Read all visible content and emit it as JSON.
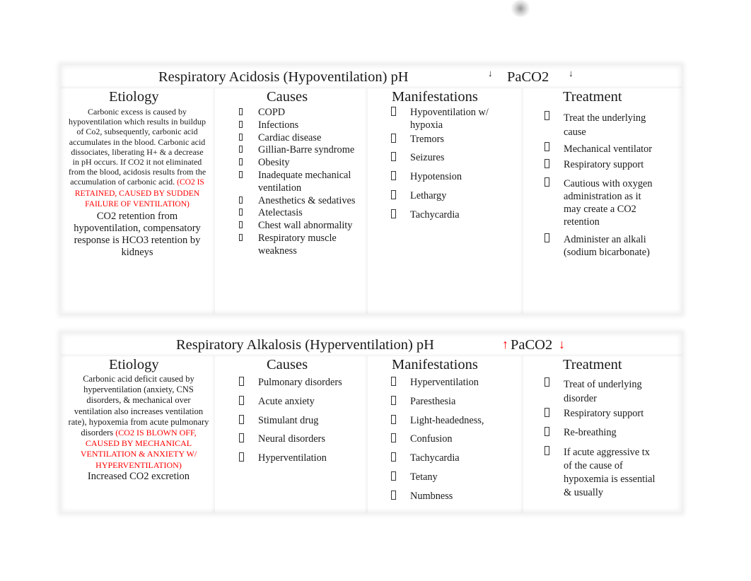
{
  "tables": [
    {
      "title": "Respiratory Acidosis (Hypoventilation) pH",
      "ph_arrow": "↓",
      "paco2_label": "PaCO2",
      "paco2_arrow": "↓",
      "headers": [
        "Etiology",
        "Causes",
        "Manifestations",
        "Treatment"
      ],
      "etiology": {
        "text": "Carbonic excess is caused by hypoventilation which results in buildup of Co2, subsequently, carbonic acid accumulates in the blood. Carbonic acid dissociates, liberating H+ & a decrease in pH occurs. If CO2 it not eliminated from the blood, acidosis results from the accumulation of carbonic acid.",
        "note": "(CO2 IS RETAINED, CAUSED BY SUDDEN FAILURE OF VENTILATION)",
        "summary": "CO2 retention from hypoventilation, compensatory response is HCO3 retention by kidneys"
      },
      "causes": [
        "COPD",
        "Infections",
        "Cardiac disease",
        "Gillian-Barre syndrome",
        "Obesity",
        "Inadequate mechanical ventilation",
        "Anesthetics & sedatives",
        "Atelectasis",
        "Chest wall abnormality",
        "Respiratory muscle weakness"
      ],
      "manifestations": [
        "Hypoventilation w/ hypoxia",
        "Tremors",
        "Seizures",
        "Hypotension",
        "Lethargy",
        "Tachycardia"
      ],
      "treatment": [
        "Treat the underlying cause",
        "Mechanical ventilator",
        "Respiratory support",
        "Cautious with oxygen administration as it may create a CO2 retention",
        "Administer an alkali (sodium bicarbonate)"
      ]
    },
    {
      "title": "Respiratory Alkalosis (Hyperventilation) pH",
      "ph_arrow": "↑",
      "paco2_label": "PaCO2",
      "paco2_arrow": "↓",
      "arrow_color": "#ff0000",
      "headers": [
        "Etiology",
        "Causes",
        "Manifestations",
        "Treatment"
      ],
      "etiology": {
        "text": "Carbonic acid deficit caused by hyperventilation (anxiety, CNS disorders, & mechanical over ventilation also increases ventilation rate), hypoxemia from acute pulmonary disorders",
        "note": "(CO2 IS BLOWN OFF, CAUSED BY MECHANICAL VENTILATION & ANXIETY W/ HYPERVENTILATION)",
        "summary": "Increased CO2 excretion"
      },
      "causes": [
        "Pulmonary disorders",
        "Acute anxiety",
        "Stimulant drug",
        "Neural disorders",
        "Hyperventilation"
      ],
      "manifestations": [
        "Hyperventilation",
        "Paresthesia",
        "Light-headedness,",
        "Confusion",
        "Tachycardia",
        "Tetany",
        "Numbness"
      ],
      "treatment": [
        "Treat of underlying disorder",
        "Respiratory support",
        "Re-breathing",
        "If acute aggressive tx of the cause of hypoxemia is essential & usually"
      ]
    }
  ]
}
